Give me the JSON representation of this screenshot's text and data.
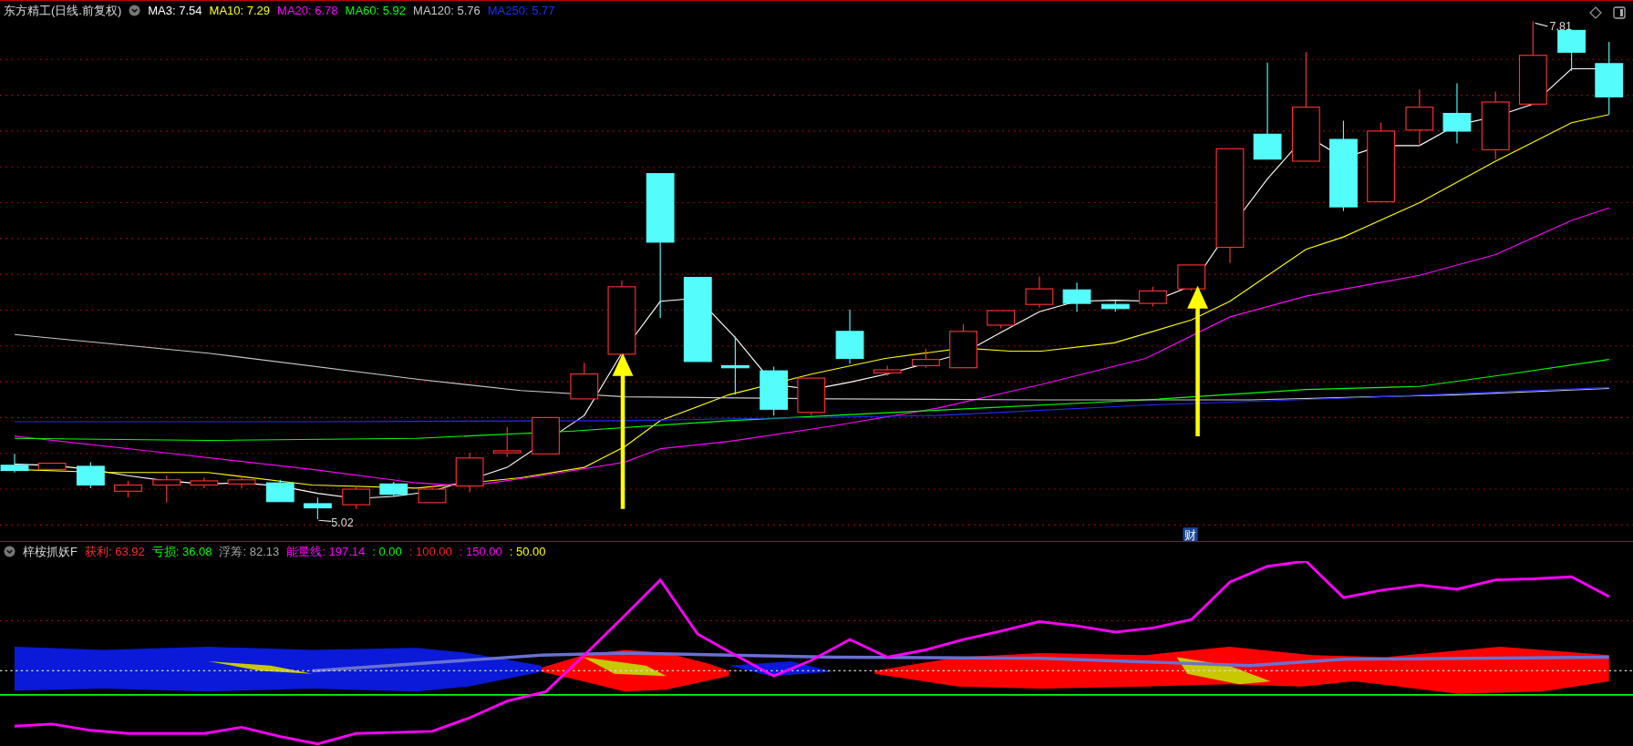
{
  "main_panel": {
    "title": "东方精工(日线.前复权)",
    "indicators": [
      {
        "text": "MA3: 7.54",
        "color": "#ffffff"
      },
      {
        "text": "MA10: 7.29",
        "color": "#ffff00"
      },
      {
        "text": "MA20: 6.78",
        "color": "#ff00ff"
      },
      {
        "text": "MA60: 5.92",
        "color": "#00ff00"
      },
      {
        "text": "MA120: 5.76",
        "color": "#c8c8c8"
      },
      {
        "text": "MA250: 5.77",
        "color": "#1e2cff"
      }
    ],
    "high_label": "7.81",
    "low_label": "5.02",
    "finance_marker": "财"
  },
  "indicator_panel": {
    "title": "梓桉抓妖F",
    "indicators": [
      {
        "text": "获利: 63.92",
        "color": "#ff2a2a"
      },
      {
        "text": "亏损: 36.08",
        "color": "#00ff00"
      },
      {
        "text": "浮筹: 82.13",
        "color": "#a8a8a8"
      },
      {
        "text": "能量线: 197.14",
        "color": "#ff00ff"
      },
      {
        "text": ": 0.00",
        "color": "#00ff00"
      },
      {
        "text": ": 100.00",
        "color": "#ff2020"
      },
      {
        "text": ": 150.00",
        "color": "#ff00ff"
      },
      {
        "text": ": 50.00",
        "color": "#ffff00"
      }
    ]
  }
}
